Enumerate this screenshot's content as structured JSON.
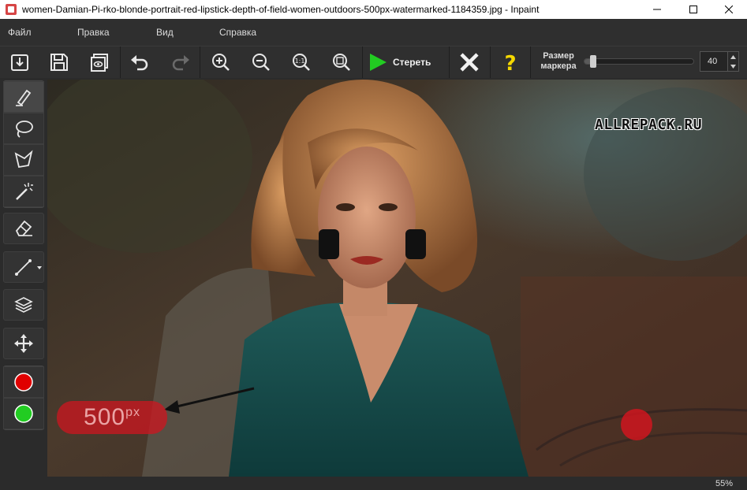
{
  "window": {
    "title": "women-Damian-Pi-rko-blonde-portrait-red-lipstick-depth-of-field-women-outdoors-500px-watermarked-1184359.jpg - Inpaint"
  },
  "menu": {
    "items": [
      {
        "label": "Файл"
      },
      {
        "label": "Правка"
      },
      {
        "label": "Вид"
      },
      {
        "label": "Справка"
      }
    ]
  },
  "toolbar": {
    "erase_label": "Стереть",
    "marker_size_label": "Размер маркера",
    "marker_size_value": "40",
    "marker_size_fraction": 0.05,
    "icons": [
      "open-icon",
      "save-icon",
      "preview-icon",
      "undo-icon",
      "redo-icon",
      "zoom-in-icon",
      "zoom-out-icon",
      "actual-size-icon",
      "fit-to-window-icon",
      "play-icon",
      "cancel-icon",
      "help-icon"
    ]
  },
  "tools": {
    "icons": [
      "marker-icon",
      "lasso-icon",
      "polygonal-lasso-icon",
      "magic-wand-icon",
      "eraser-icon",
      "line-icon",
      "layers-icon",
      "move-icon",
      "red-color-icon",
      "green-color-icon"
    ],
    "colors": {
      "red": "#e00000",
      "green": "#22cc22"
    }
  },
  "canvas": {
    "watermark_text": "ALLREPACK.RU",
    "selected_watermark_text": "500",
    "selected_watermark_sup": "px",
    "mask_color": "#d2141e"
  },
  "status": {
    "zoom": "55%"
  }
}
